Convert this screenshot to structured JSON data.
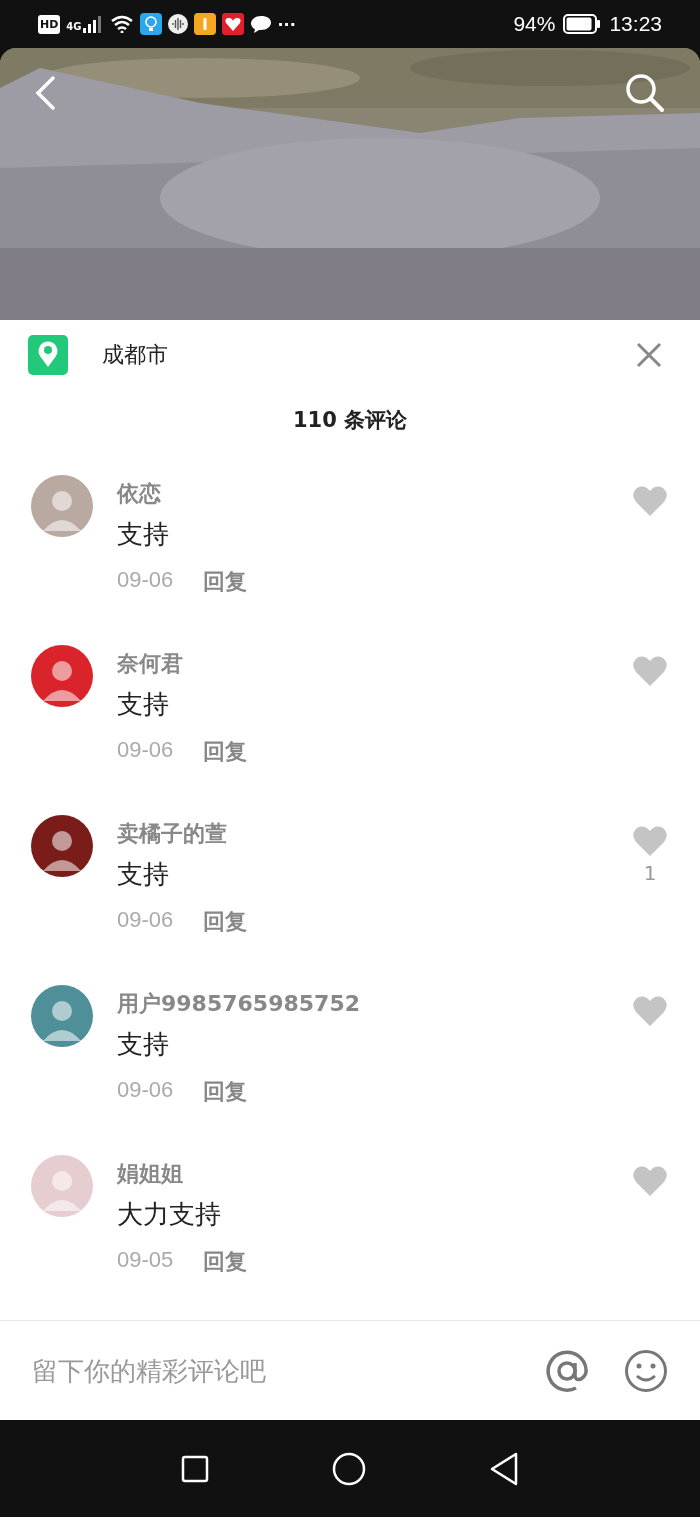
{
  "status_bar": {
    "hd": "HD",
    "network": "4G",
    "more": "···",
    "battery_text": "94%",
    "time": "13:23"
  },
  "location": {
    "name": "成都市"
  },
  "comments_title": "110 条评论",
  "comments": [
    {
      "user": "依恋",
      "text": "支持",
      "date": "09-06",
      "reply": "回复",
      "liked": false
    },
    {
      "user": "奈何君",
      "text": "支持",
      "date": "09-06",
      "reply": "回复",
      "liked": false
    },
    {
      "user": "卖橘子的萱",
      "text": "支持",
      "date": "09-06",
      "reply": "回复",
      "liked": false,
      "likes": "1"
    },
    {
      "user": "用户9985765985752",
      "text": "支持",
      "date": "09-06",
      "reply": "回复",
      "liked": false
    },
    {
      "user": "娟姐姐",
      "text": "大力支持",
      "date": "09-05",
      "reply": "回复",
      "liked": false
    }
  ],
  "input": {
    "placeholder": "留下你的精彩评论吧"
  }
}
